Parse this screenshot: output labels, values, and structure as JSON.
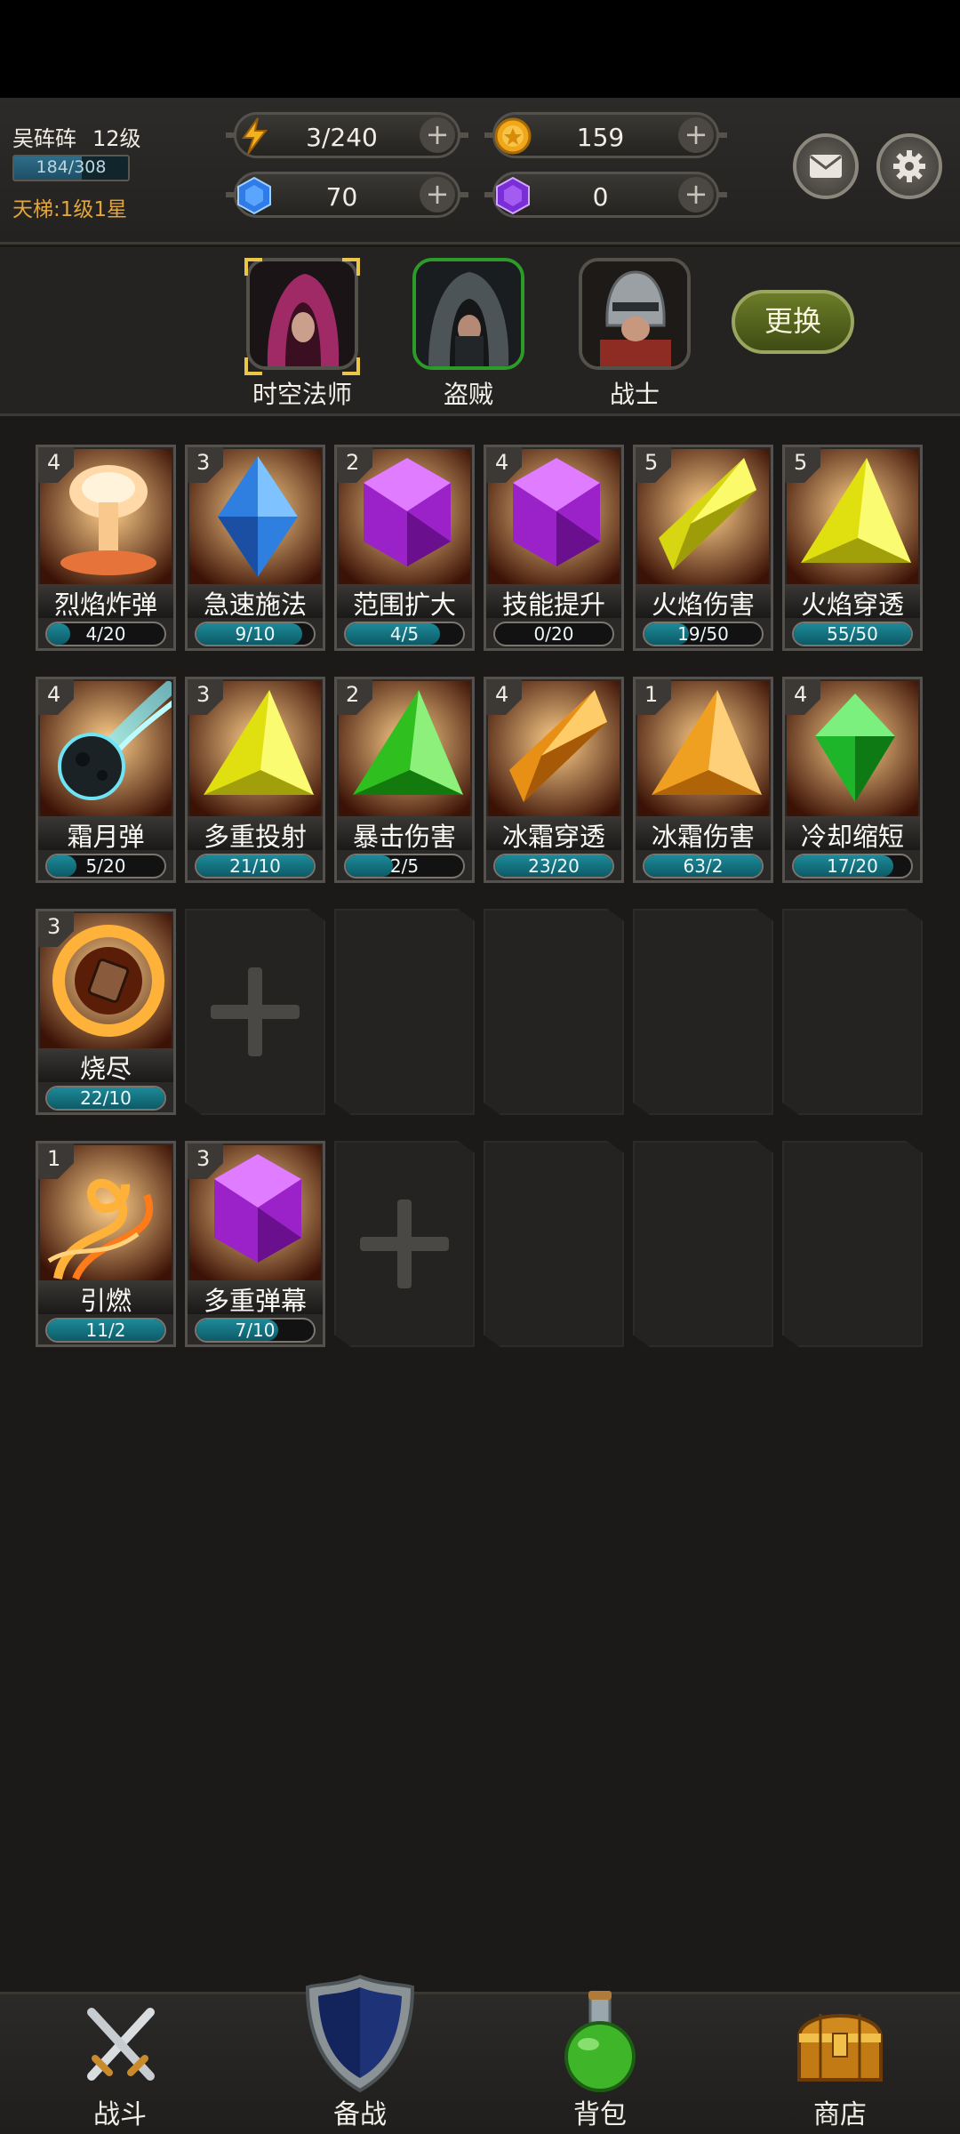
{
  "player": {
    "name": "吴砗砗",
    "level": "12级",
    "exp_text": "184/308",
    "exp_fraction": 0.597,
    "ladder": "天梯:1级1星"
  },
  "resources": [
    {
      "icon": "lightning-icon",
      "value": "3/240"
    },
    {
      "icon": "gold-coin-icon",
      "value": "159"
    },
    {
      "icon": "blue-gem-icon",
      "value": "70"
    },
    {
      "icon": "purple-gem-icon",
      "value": "0"
    }
  ],
  "header_buttons": {
    "mail_icon": "mail-icon",
    "settings_icon": "gear-icon"
  },
  "characters": [
    {
      "name": "时空法师",
      "state": "selected"
    },
    {
      "name": "盗贼",
      "state": "active"
    },
    {
      "name": "战士",
      "state": "normal"
    }
  ],
  "change_button": "更换",
  "skill_rows": [
    [
      {
        "level": "4",
        "name": "烈焰炸弹",
        "progress": "4/20",
        "fill": 0.2,
        "art": "explosion"
      },
      {
        "level": "3",
        "name": "急速施法",
        "progress": "9/10",
        "fill": 0.9,
        "art": "blue-crystal"
      },
      {
        "level": "2",
        "name": "范围扩大",
        "progress": "4/5",
        "fill": 0.8,
        "art": "purple-gem"
      },
      {
        "level": "4",
        "name": "技能提升",
        "progress": "0/20",
        "fill": 0,
        "art": "purple-gem"
      },
      {
        "level": "5",
        "name": "火焰伤害",
        "progress": "19/50",
        "fill": 0.38,
        "art": "yellow-diamond"
      },
      {
        "level": "5",
        "name": "火焰穿透",
        "progress": "55/50",
        "fill": 1,
        "art": "yellow-triangle"
      }
    ],
    [
      {
        "level": "4",
        "name": "霜月弹",
        "progress": "5/20",
        "fill": 0.25,
        "art": "ice-meteor"
      },
      {
        "level": "3",
        "name": "多重投射",
        "progress": "21/10",
        "fill": 1,
        "art": "yellow-triangle"
      },
      {
        "level": "2",
        "name": "暴击伤害",
        "progress": "2/5",
        "fill": 0.4,
        "art": "green-triangle"
      },
      {
        "level": "4",
        "name": "冰霜穿透",
        "progress": "23/20",
        "fill": 1,
        "art": "orange-diamond"
      },
      {
        "level": "1",
        "name": "冰霜伤害",
        "progress": "63/2",
        "fill": 1,
        "art": "orange-triangle"
      },
      {
        "level": "4",
        "name": "冷却缩短",
        "progress": "17/20",
        "fill": 0.85,
        "art": "green-gem"
      }
    ],
    [
      {
        "level": "3",
        "name": "烧尽",
        "progress": "22/10",
        "fill": 1,
        "art": "fire-rune"
      },
      {
        "empty": "add"
      },
      {
        "empty": "blank"
      },
      {
        "empty": "blank"
      },
      {
        "empty": "blank"
      },
      {
        "empty": "blank"
      }
    ],
    [
      {
        "level": "1",
        "name": "引燃",
        "progress": "11/2",
        "fill": 1,
        "art": "flame-swirl"
      },
      {
        "level": "3",
        "name": "多重弹幕",
        "progress": "7/10",
        "fill": 0.7,
        "art": "purple-gem"
      },
      {
        "empty": "add"
      },
      {
        "empty": "blank"
      },
      {
        "empty": "blank"
      },
      {
        "empty": "blank"
      }
    ]
  ],
  "nav": [
    {
      "label": "战斗",
      "icon": "crossed-swords-icon"
    },
    {
      "label": "备战",
      "icon": "shield-icon",
      "active": true
    },
    {
      "label": "背包",
      "icon": "potion-icon"
    },
    {
      "label": "商店",
      "icon": "treasure-chest-icon"
    }
  ]
}
